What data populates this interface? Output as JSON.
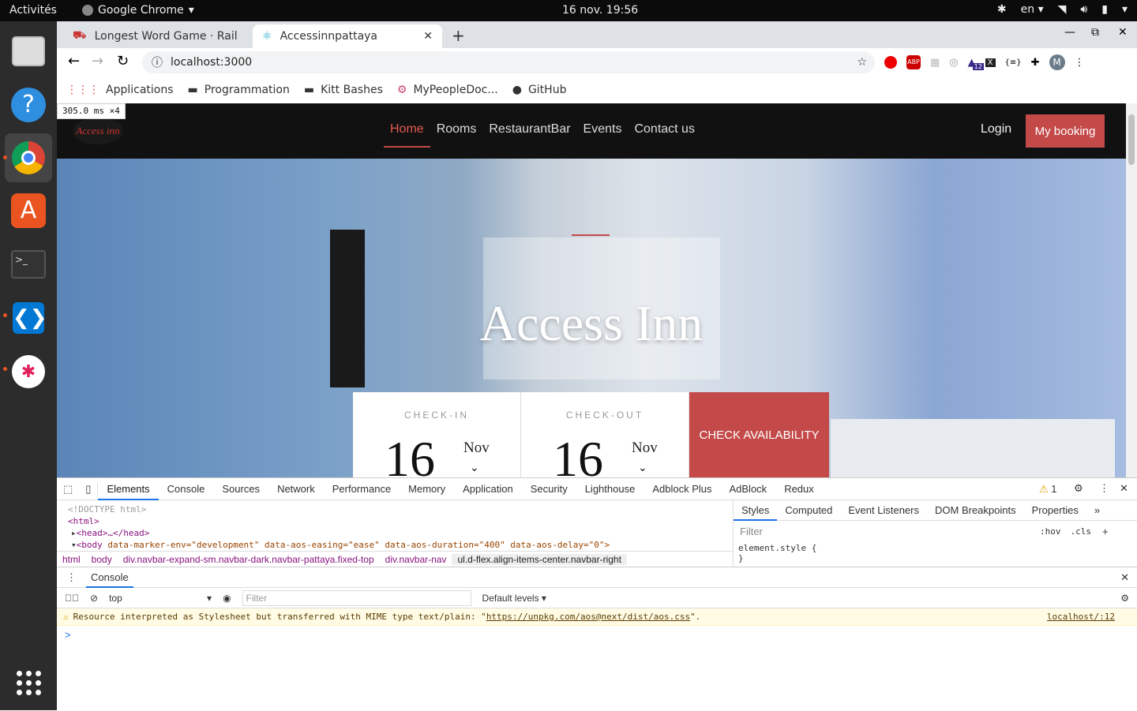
{
  "topbar": {
    "activities": "Activités",
    "app_name": "Google Chrome",
    "clock": "16 nov.  19:56",
    "lang": "en"
  },
  "dock": {
    "items": [
      "files",
      "help",
      "chrome",
      "software",
      "terminal",
      "vscode",
      "slack",
      "apps-grid"
    ]
  },
  "browser": {
    "tabs": [
      {
        "title": "Longest Word Game · Rail",
        "icon": "rails-icon"
      },
      {
        "title": "Accessinnpattaya",
        "icon": "react-icon"
      }
    ],
    "url": "localhost:3000",
    "bookmarks": [
      "Applications",
      "Programmation",
      "Kitt Bashes",
      "MyPeopleDoc...",
      "GitHub"
    ],
    "extension_badge": "12",
    "profile_initial": "M"
  },
  "page": {
    "timing_overlay": "305.0 ms ×4",
    "nav": [
      "Home",
      "Rooms",
      "RestaurantBar",
      "Events",
      "Contact us"
    ],
    "login": "Login",
    "my_booking": "My booking",
    "hero_title": "Access Inn",
    "checkin_label": "CHECK-IN",
    "checkout_label": "CHECK-OUT",
    "checkin_day": "16",
    "checkin_month": "Nov",
    "checkout_day": "16",
    "checkout_month": "Nov",
    "check_button": "CHECK AVAILABILITY",
    "logo_text": "Access inn"
  },
  "devtools": {
    "tabs": [
      "Elements",
      "Console",
      "Sources",
      "Network",
      "Performance",
      "Memory",
      "Application",
      "Security",
      "Lighthouse",
      "Adblock Plus",
      "AdBlock",
      "Redux"
    ],
    "warnings_count": "1",
    "dom_lines": {
      "doctype": "<!DOCTYPE html>",
      "html": "<html>",
      "head": "<head>…</head>",
      "body_tag": "<body",
      "body_attrs": "data-marker-env=\"development\" data-aos-easing=\"ease\" data-aos-duration=\"400\" data-aos-delay=\"0\">"
    },
    "breadcrumbs": [
      "html",
      "body",
      "div.navbar-expand-sm.navbar-dark.navbar-pattaya.fixed-top",
      "div.navbar-nav",
      "ul.d-flex.align-items-center.navbar-right"
    ],
    "styles_tabs": [
      "Styles",
      "Computed",
      "Event Listeners",
      "DOM Breakpoints",
      "Properties"
    ],
    "styles_filter": "Filter",
    "hov": ":hov",
    "cls": ".cls",
    "element_style": "element.style {",
    "element_style_close": "}",
    "console": {
      "title": "Console",
      "context": "top",
      "filter": "Filter",
      "levels": "Default levels",
      "warning_text": "Resource interpreted as Stylesheet but transferred with MIME type text/plain: \"",
      "warning_link": "https://unpkg.com/aos@next/dist/aos.css",
      "warning_end": "\".",
      "warning_source": "localhost/:12",
      "prompt": ">"
    }
  }
}
